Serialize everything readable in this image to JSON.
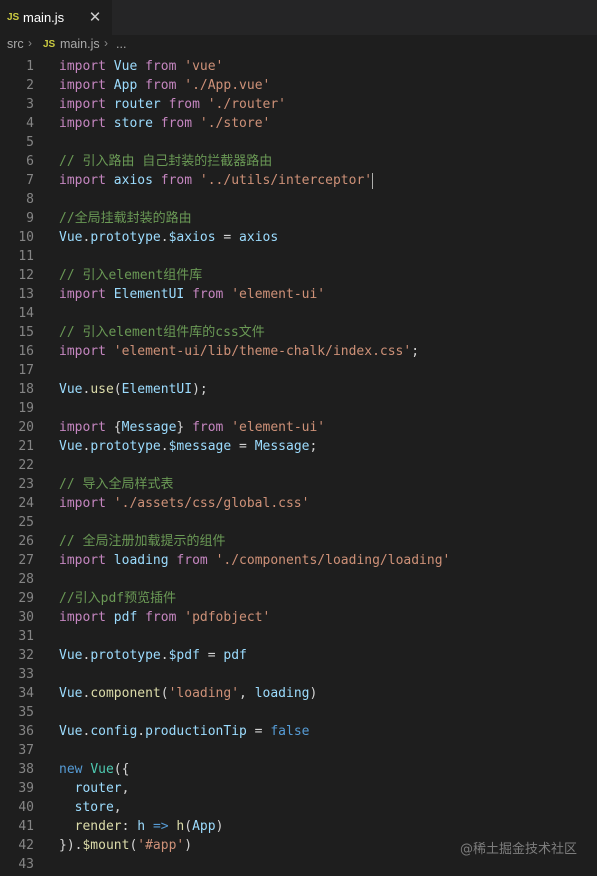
{
  "tab": {
    "badge": "JS",
    "label": "main.js",
    "close": "✕"
  },
  "breadcrumb": {
    "folder": "src",
    "badge": "JS",
    "file": "main.js",
    "more": "..."
  },
  "watermark": "@稀土掘金技术社区",
  "lines": [
    {
      "n": "1",
      "tokens": [
        [
          "kw",
          "import"
        ],
        [
          "pl",
          " "
        ],
        [
          "vr",
          "Vue"
        ],
        [
          "pl",
          " "
        ],
        [
          "kw",
          "from"
        ],
        [
          "pl",
          " "
        ],
        [
          "st",
          "'vue'"
        ]
      ]
    },
    {
      "n": "2",
      "tokens": [
        [
          "kw",
          "import"
        ],
        [
          "pl",
          " "
        ],
        [
          "vr",
          "App"
        ],
        [
          "pl",
          " "
        ],
        [
          "kw",
          "from"
        ],
        [
          "pl",
          " "
        ],
        [
          "st",
          "'./App.vue'"
        ]
      ]
    },
    {
      "n": "3",
      "tokens": [
        [
          "kw",
          "import"
        ],
        [
          "pl",
          " "
        ],
        [
          "vr",
          "router"
        ],
        [
          "pl",
          " "
        ],
        [
          "kw",
          "from"
        ],
        [
          "pl",
          " "
        ],
        [
          "st",
          "'./router'"
        ]
      ]
    },
    {
      "n": "4",
      "tokens": [
        [
          "kw",
          "import"
        ],
        [
          "pl",
          " "
        ],
        [
          "vr",
          "store"
        ],
        [
          "pl",
          " "
        ],
        [
          "kw",
          "from"
        ],
        [
          "pl",
          " "
        ],
        [
          "st",
          "'./store'"
        ]
      ]
    },
    {
      "n": "5",
      "tokens": []
    },
    {
      "n": "6",
      "tokens": [
        [
          "cm",
          "// 引入路由 自己封装的拦截器路由"
        ]
      ]
    },
    {
      "n": "7",
      "tokens": [
        [
          "kw",
          "import"
        ],
        [
          "pl",
          " "
        ],
        [
          "vr",
          "axios"
        ],
        [
          "pl",
          " "
        ],
        [
          "kw",
          "from"
        ],
        [
          "pl",
          " "
        ],
        [
          "st",
          "'../utils/interceptor'"
        ]
      ],
      "cursor": true
    },
    {
      "n": "8",
      "tokens": []
    },
    {
      "n": "9",
      "tokens": [
        [
          "cm",
          "//全局挂载封装的路由"
        ]
      ]
    },
    {
      "n": "10",
      "tokens": [
        [
          "vr",
          "Vue"
        ],
        [
          "pl",
          "."
        ],
        [
          "vr",
          "prototype"
        ],
        [
          "pl",
          "."
        ],
        [
          "vr",
          "$axios"
        ],
        [
          "pl",
          " = "
        ],
        [
          "vr",
          "axios"
        ]
      ]
    },
    {
      "n": "11",
      "tokens": []
    },
    {
      "n": "12",
      "tokens": [
        [
          "cm",
          "// 引入element组件库"
        ]
      ]
    },
    {
      "n": "13",
      "tokens": [
        [
          "kw",
          "import"
        ],
        [
          "pl",
          " "
        ],
        [
          "vr",
          "ElementUI"
        ],
        [
          "pl",
          " "
        ],
        [
          "kw",
          "from"
        ],
        [
          "pl",
          " "
        ],
        [
          "st",
          "'element-ui'"
        ]
      ]
    },
    {
      "n": "14",
      "tokens": []
    },
    {
      "n": "15",
      "tokens": [
        [
          "cm",
          "// 引入element组件库的css文件"
        ]
      ]
    },
    {
      "n": "16",
      "tokens": [
        [
          "kw",
          "import"
        ],
        [
          "pl",
          " "
        ],
        [
          "st",
          "'element-ui/lib/theme-chalk/index.css'"
        ],
        [
          "pl",
          ";"
        ]
      ]
    },
    {
      "n": "17",
      "tokens": []
    },
    {
      "n": "18",
      "tokens": [
        [
          "vr",
          "Vue"
        ],
        [
          "pl",
          "."
        ],
        [
          "fn",
          "use"
        ],
        [
          "pl",
          "("
        ],
        [
          "vr",
          "ElementUI"
        ],
        [
          "pl",
          ");"
        ]
      ]
    },
    {
      "n": "19",
      "tokens": []
    },
    {
      "n": "20",
      "tokens": [
        [
          "kw",
          "import"
        ],
        [
          "pl",
          " {"
        ],
        [
          "vr",
          "Message"
        ],
        [
          "pl",
          "} "
        ],
        [
          "kw",
          "from"
        ],
        [
          "pl",
          " "
        ],
        [
          "st",
          "'element-ui'"
        ]
      ]
    },
    {
      "n": "21",
      "tokens": [
        [
          "vr",
          "Vue"
        ],
        [
          "pl",
          "."
        ],
        [
          "vr",
          "prototype"
        ],
        [
          "pl",
          "."
        ],
        [
          "vr",
          "$message"
        ],
        [
          "pl",
          " = "
        ],
        [
          "vr",
          "Message"
        ],
        [
          "pl",
          ";"
        ]
      ]
    },
    {
      "n": "22",
      "tokens": []
    },
    {
      "n": "23",
      "tokens": [
        [
          "cm",
          "// 导入全局样式表"
        ]
      ]
    },
    {
      "n": "24",
      "tokens": [
        [
          "kw",
          "import"
        ],
        [
          "pl",
          " "
        ],
        [
          "st",
          "'./assets/css/global.css'"
        ]
      ]
    },
    {
      "n": "25",
      "tokens": []
    },
    {
      "n": "26",
      "tokens": [
        [
          "cm",
          "// 全局注册加载提示的组件"
        ]
      ]
    },
    {
      "n": "27",
      "tokens": [
        [
          "kw",
          "import"
        ],
        [
          "pl",
          " "
        ],
        [
          "vr",
          "loading"
        ],
        [
          "pl",
          " "
        ],
        [
          "kw",
          "from"
        ],
        [
          "pl",
          " "
        ],
        [
          "st",
          "'./components/loading/loading'"
        ]
      ]
    },
    {
      "n": "28",
      "tokens": []
    },
    {
      "n": "29",
      "tokens": [
        [
          "cm",
          "//引入pdf预览插件"
        ]
      ]
    },
    {
      "n": "30",
      "tokens": [
        [
          "kw",
          "import"
        ],
        [
          "pl",
          " "
        ],
        [
          "vr",
          "pdf"
        ],
        [
          "pl",
          " "
        ],
        [
          "kw",
          "from"
        ],
        [
          "pl",
          " "
        ],
        [
          "st",
          "'pdfobject'"
        ]
      ]
    },
    {
      "n": "31",
      "tokens": []
    },
    {
      "n": "32",
      "tokens": [
        [
          "vr",
          "Vue"
        ],
        [
          "pl",
          "."
        ],
        [
          "vr",
          "prototype"
        ],
        [
          "pl",
          "."
        ],
        [
          "vr",
          "$pdf"
        ],
        [
          "pl",
          " = "
        ],
        [
          "vr",
          "pdf"
        ]
      ]
    },
    {
      "n": "33",
      "tokens": []
    },
    {
      "n": "34",
      "tokens": [
        [
          "vr",
          "Vue"
        ],
        [
          "pl",
          "."
        ],
        [
          "fn",
          "component"
        ],
        [
          "pl",
          "("
        ],
        [
          "st",
          "'loading'"
        ],
        [
          "pl",
          ", "
        ],
        [
          "vr",
          "loading"
        ],
        [
          "pl",
          ")"
        ]
      ]
    },
    {
      "n": "35",
      "tokens": []
    },
    {
      "n": "36",
      "tokens": [
        [
          "vr",
          "Vue"
        ],
        [
          "pl",
          "."
        ],
        [
          "vr",
          "config"
        ],
        [
          "pl",
          "."
        ],
        [
          "vr",
          "productionTip"
        ],
        [
          "pl",
          " = "
        ],
        [
          "bl",
          "false"
        ]
      ]
    },
    {
      "n": "37",
      "tokens": []
    },
    {
      "n": "38",
      "tokens": [
        [
          "bl",
          "new"
        ],
        [
          "pl",
          " "
        ],
        [
          "ty",
          "Vue"
        ],
        [
          "pl",
          "({"
        ]
      ]
    },
    {
      "n": "39",
      "tokens": [
        [
          "pl",
          "  "
        ],
        [
          "vr",
          "router"
        ],
        [
          "pl",
          ","
        ]
      ]
    },
    {
      "n": "40",
      "tokens": [
        [
          "pl",
          "  "
        ],
        [
          "vr",
          "store"
        ],
        [
          "pl",
          ","
        ]
      ]
    },
    {
      "n": "41",
      "tokens": [
        [
          "pl",
          "  "
        ],
        [
          "fn",
          "render"
        ],
        [
          "pl",
          ": "
        ],
        [
          "vr",
          "h"
        ],
        [
          "pl",
          " "
        ],
        [
          "bl",
          "=>"
        ],
        [
          "pl",
          " "
        ],
        [
          "fn",
          "h"
        ],
        [
          "pl",
          "("
        ],
        [
          "vr",
          "App"
        ],
        [
          "pl",
          ")"
        ]
      ]
    },
    {
      "n": "42",
      "tokens": [
        [
          "pl",
          "})."
        ],
        [
          "fn",
          "$mount"
        ],
        [
          "pl",
          "("
        ],
        [
          "st",
          "'#app'"
        ],
        [
          "pl",
          ")"
        ]
      ]
    },
    {
      "n": "43",
      "tokens": []
    }
  ]
}
